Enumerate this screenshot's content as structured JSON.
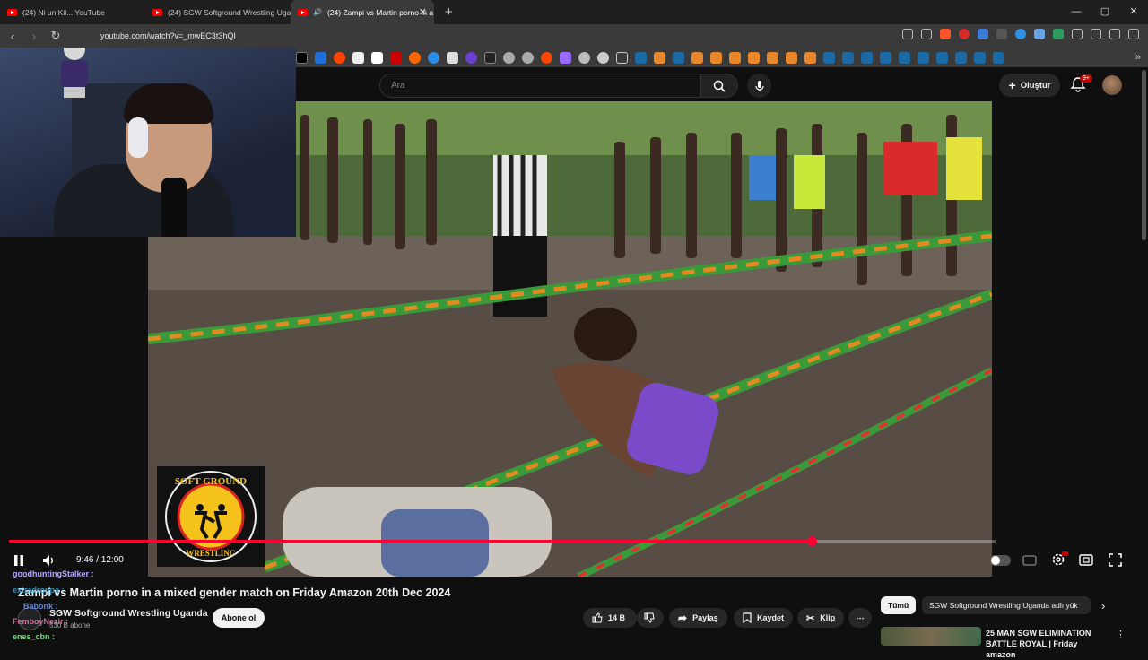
{
  "browser": {
    "tabs": [
      {
        "title": "(24) Ni un Kil... YouTube"
      },
      {
        "title": "(24) SGW Softground Wrestling Uganda"
      },
      {
        "title": "(24) Zampi vs Martin porno in a m"
      }
    ],
    "new_tab": "+",
    "url": "youtube.com/watch?v=_mwEC3t3hQI",
    "window_controls": [
      "—",
      "▢",
      "✕"
    ]
  },
  "youtube": {
    "search_placeholder": "Ara",
    "create_label": "Oluştur",
    "notif_badge": "9+"
  },
  "player": {
    "time": "9:46 / 12:00",
    "progress_fraction": 0.8139,
    "logo_text_top": "SOFT GROUND",
    "logo_text_bottom": "WRESTLING"
  },
  "video_info": {
    "title": "Zampi vs Martin porno in a mixed gender match on Friday Amazon 20th Dec 2024",
    "channel": "SGW Softground Wrestling Uganda",
    "subscribers": "530 B abone",
    "subscribe_label": "Abone ol",
    "like_count": "14 B",
    "share_label": "Paylaş",
    "save_label": "Kaydet",
    "clip_label": "Klip",
    "more_label": "⋯"
  },
  "chat": [
    {
      "user": "goodhuntingStalker :",
      "color": "#b9a7ff"
    },
    {
      "user": "extradroppa :",
      "color": "#4fc3f7"
    },
    {
      "user": "Babonk :",
      "color": "#7aa2ff"
    },
    {
      "user": "FemboyNezir :",
      "color": "#ff80c0"
    },
    {
      "user": "enes_cbn :",
      "color": "#7cd67c"
    }
  ],
  "sidebar": {
    "chip_all": "Tümü",
    "chip_channel": "SGW Softground Wrestling Uganda adlı yük",
    "rec_title": "25 MAN SGW ELIMINATION BATTLE ROYAL | Friday amazon"
  },
  "colors": {
    "accent": "#ff0033",
    "brand": "#ff0000"
  }
}
